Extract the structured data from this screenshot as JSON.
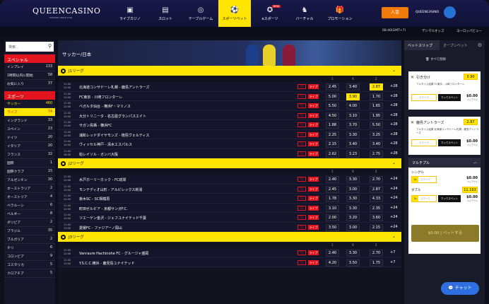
{
  "brand": {
    "name": "QUEENCASINO",
    "tagline": "TRUSTED SINCE 2016"
  },
  "nav": [
    {
      "label": "ライブカジノ",
      "icon": "live-casino-icon",
      "glyph": "▣"
    },
    {
      "label": "スロット",
      "icon": "slot-icon",
      "glyph": "▤"
    },
    {
      "label": "テーブルゲーム",
      "icon": "roulette-icon",
      "glyph": "◎"
    },
    {
      "label": "スポーツベット",
      "icon": "soccer-ball-icon",
      "glyph": "⚽"
    },
    {
      "label": "eスポーツ",
      "icon": "esports-icon",
      "glyph": "✪",
      "badge": "NEW"
    },
    {
      "label": "バーチャル",
      "icon": "virtual-horse-icon",
      "glyph": "♞"
    },
    {
      "label": "プロモーション",
      "icon": "promotion-icon",
      "glyph": "🎁"
    }
  ],
  "header": {
    "deposit_label": "入金",
    "account_name": "QUEENCASINO",
    "avatar_glyph": "👤"
  },
  "subbar": {
    "time": "08:40(GMT+7)",
    "odds_format": "デシマルオッズ",
    "region": "ヨーロッパビュー"
  },
  "sidebar": {
    "search_placeholder": "検索..",
    "special_title": "スペシャル",
    "special_items": [
      {
        "label": "インプレイ",
        "count": "133"
      },
      {
        "label": "1時間以内に開始",
        "count": "58"
      },
      {
        "label": "お気に入り",
        "count": "37"
      }
    ],
    "sports_title": "スポーツ",
    "sports_items": [
      {
        "label": "サッカー",
        "count": "460",
        "state": "active"
      },
      {
        "label": "ライブ",
        "count": "74",
        "state": "live"
      },
      {
        "label": "イングランド",
        "count": "33"
      },
      {
        "label": "スペイン",
        "count": "23"
      },
      {
        "label": "ドイツ",
        "count": "20"
      },
      {
        "label": "イタリア",
        "count": "20"
      },
      {
        "label": "フランス",
        "count": "32"
      },
      {
        "label": "国際",
        "count": "1"
      },
      {
        "label": "国際クラブ",
        "count": "15"
      },
      {
        "label": "アルゼンチン",
        "count": "30"
      },
      {
        "label": "オーストラリア",
        "count": "2"
      },
      {
        "label": "オーストリア",
        "count": "4"
      },
      {
        "label": "ベラルーシ",
        "count": "6"
      },
      {
        "label": "ベルギー",
        "count": "8"
      },
      {
        "label": "ボリビア",
        "count": "2"
      },
      {
        "label": "ブラジル",
        "count": "35"
      },
      {
        "label": "ブルガリア",
        "count": "2"
      },
      {
        "label": "チリ",
        "count": "6"
      },
      {
        "label": "コロンビア",
        "count": "9"
      },
      {
        "label": "コスタリカ",
        "count": "5"
      },
      {
        "label": "クロアチア",
        "count": "5"
      }
    ]
  },
  "main": {
    "title": "サッカー/日本",
    "col_headers": [
      "1",
      "X",
      "2"
    ],
    "tv_label": "TV",
    "live_label": "ライブ",
    "leagues": [
      {
        "name": "J1リーグ",
        "matches": [
          {
            "date": "11.04",
            "time": "12:00",
            "teams": "北海道コンサドーレ札幌 - 鹿島アントラーズ",
            "o1": "2.45",
            "ox": "3.40",
            "o2": "2.87",
            "more": "+28",
            "sel": 2
          },
          {
            "date": "11.04",
            "time": "12:00",
            "teams": "FC東京 - 川崎フロンターレ",
            "o1": "5.00",
            "ox": "3.90",
            "o2": "1.70",
            "more": "+28",
            "sel": 1
          },
          {
            "date": "11.04",
            "time": "12:00",
            "teams": "ベガルタ仙台 - 横浜F・マリノス",
            "o1": "5.50",
            "ox": "4.00",
            "o2": "1.65",
            "more": "+28",
            "sel": -1
          },
          {
            "date": "11.04",
            "time": "12:00",
            "teams": "大分トリニータ - 名古屋グランパスエイト",
            "o1": "4.50",
            "ox": "3.10",
            "o2": "1.95",
            "more": "+28",
            "sel": -1
          },
          {
            "date": "11.04",
            "time": "13:00",
            "teams": "サガン鳥栖 - 横浜FC",
            "o1": "1.88",
            "ox": "3.70",
            "o2": "5.50",
            "more": "+28",
            "sel": -1
          },
          {
            "date": "11.04",
            "time": "14:00",
            "teams": "浦和レッドダイヤモンズ - 徳島ヴォルティス",
            "o1": "2.25",
            "ox": "3.30",
            "o2": "3.25",
            "more": "+28",
            "sel": -1
          },
          {
            "date": "11.04",
            "time": "14:00",
            "teams": "ヴィッセル神戸 - 清水エスパルス",
            "o1": "2.15",
            "ox": "3.40",
            "o2": "3.40",
            "more": "+28",
            "sel": -1
          },
          {
            "date": "11.04",
            "time": "18:00",
            "teams": "柏レイソル - ガンバ大阪",
            "o1": "2.62",
            "ox": "3.23",
            "o2": "2.75",
            "more": "+28",
            "sel": -1
          }
        ]
      },
      {
        "name": "J2リーグ",
        "matches": [
          {
            "date": "11.04",
            "time": "12:00",
            "teams": "水戸ホーリーホック - FC琉球",
            "o1": "2.40",
            "ox": "3.30",
            "o2": "2.70",
            "more": "+24",
            "sel": -1
          },
          {
            "date": "11.04",
            "time": "12:00",
            "teams": "モンテディオ山形 - アルビレックス新潟",
            "o1": "2.45",
            "ox": "3.00",
            "o2": "2.87",
            "more": "+24",
            "sel": -1
          },
          {
            "date": "11.04",
            "time": "12:00",
            "teams": "栃木SC - SC相模原",
            "o1": "1.78",
            "ox": "3.30",
            "o2": "4.33",
            "more": "+24",
            "sel": -1
          },
          {
            "date": "11.04",
            "time": "12:00",
            "teams": "町田ゼルビア - 京都サンガF.C.",
            "o1": "3.10",
            "ox": "3.30",
            "o2": "2.35",
            "more": "+24",
            "sel": -1
          },
          {
            "date": "11.04",
            "time": "12:00",
            "teams": "ツエーゲン金沢 - ジェフユナイテッド千葉",
            "o1": "2.00",
            "ox": "3.20",
            "o2": "3.60",
            "more": "+24",
            "sel": -1
          },
          {
            "date": "11.04",
            "time": "13:00",
            "teams": "愛媛FC - ファジアーノ岡山",
            "o1": "3.50",
            "ox": "3.00",
            "o2": "2.15",
            "more": "+24",
            "sel": -1
          }
        ]
      },
      {
        "name": "J3リーグ",
        "matches": [
          {
            "date": "11.04",
            "time": "12:00",
            "teams": "Vanraure Hachinohe FC - グルージャ盛岡",
            "o1": "2.40",
            "ox": "3.30",
            "o2": "2.70",
            "more": "+7",
            "sel": -1
          },
          {
            "date": "11.04",
            "time": "13:00",
            "teams": "Y.S.C.C.横浜 - 鹿児島ユナイテッド",
            "o1": "4.20",
            "ox": "3.50",
            "o2": "1.75",
            "more": "+7",
            "sel": -1
          }
        ]
      }
    ]
  },
  "betslip": {
    "tab_slip": "ベットスリップ",
    "tab_open": "オープンベット",
    "clear_all": "すべて削除",
    "bets": [
      {
        "selection": "引き分け",
        "price": "3.90",
        "desc": "フルタイム結果 FC東京 - 川崎フロンターレ",
        "stake_placeholder": "ステーク",
        "max_label": "マックスベット",
        "amount": "$0.00",
        "payout_label": "ペイアウト"
      },
      {
        "selection": "鹿島アントラーズ",
        "price": "2.87",
        "desc": "フルタイム結果 北海道コンサドーレ札幌 - 鹿島アントラーズ",
        "stake_placeholder": "ステーク",
        "max_label": "マックスベット",
        "amount": "$0.00",
        "payout_label": "ペイアウト"
      }
    ],
    "multiple": {
      "title": "マルチプル",
      "single_label": "シングル",
      "single_mult": "2x",
      "single_amount": "$0.00",
      "double_label": "ダブル",
      "double_price": "11.193",
      "double_mult": "1x",
      "double_amount": "$0.00",
      "payout_label": "ペイアウト"
    },
    "place_label": "$0.00 | ベットする"
  },
  "chat_label": "チャット"
}
